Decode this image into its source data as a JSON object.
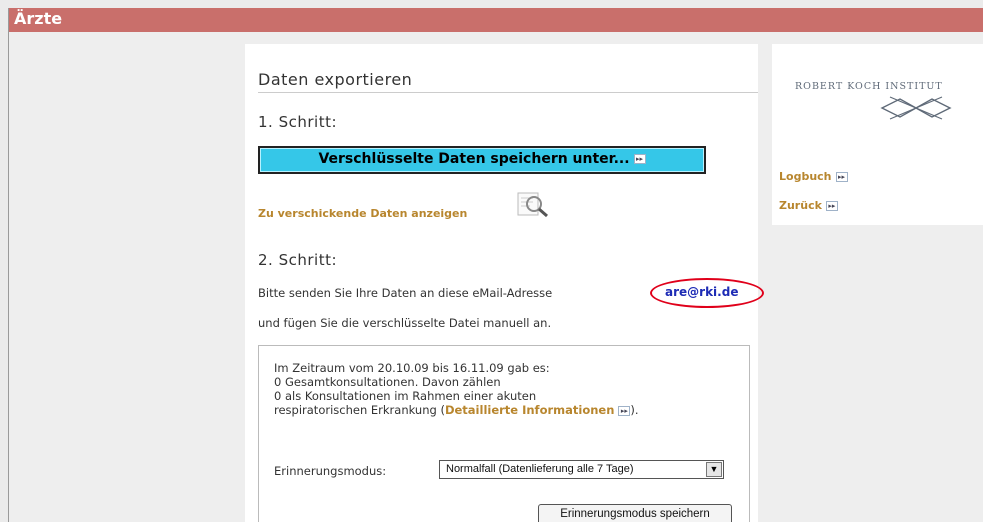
{
  "header": {
    "title": "Ärzte"
  },
  "main": {
    "title": "Daten exportieren",
    "step1": "1. Schritt:",
    "save_button": "Verschlüsselte Daten speichern unter...",
    "show_data_link": "Zu verschickende Daten anzeigen",
    "step2": "2. Schritt:",
    "send_text": "Bitte senden Sie Ihre Daten an diese eMail-Adresse",
    "email": "are@rki.de",
    "attach_text": "und fügen Sie die verschlüsselte Datei manuell an."
  },
  "info": {
    "line1": "Im Zeitraum vom 20.10.09 bis 16.11.09 gab es:",
    "line2": "0 Gesamtkonsultationen. Davon zählen",
    "line3": "0 als Konsultationen im Rahmen einer akuten",
    "line4_prefix": "respiratorischen Erkrankung (",
    "detail_link": "Detaillierte Informationen",
    "line4_suffix": ").",
    "mode_label": "Erinnerungsmodus:",
    "mode_value": "Normalfall (Datenlieferung alle 7 Tage)",
    "mode_save": "Erinnerungsmodus speichern"
  },
  "sidebar": {
    "logo_text": "ROBERT KOCH INSTITUT",
    "logbook": "Logbuch",
    "back": "Zurück"
  },
  "colors": {
    "header": "#c96f6b",
    "button": "#35c7e8",
    "link": "#b8862e",
    "email": "#1d2bb5",
    "highlight": "#e0001a"
  }
}
